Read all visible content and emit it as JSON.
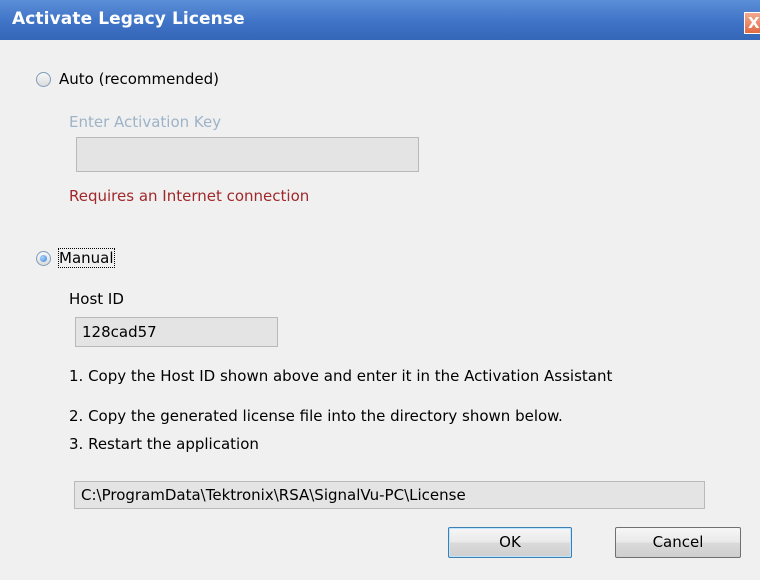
{
  "dialog": {
    "title": "Activate Legacy License",
    "close_label": "X"
  },
  "auto": {
    "label": "Auto (recommended)",
    "selected": false,
    "key_label": "Enter Activation Key",
    "key_value": "",
    "internet_note": "Requires an Internet connection"
  },
  "manual": {
    "label": "Manual",
    "selected": true,
    "host_id_label": "Host ID",
    "host_id_value": "128cad57",
    "steps": [
      "1. Copy the Host ID shown above and enter it in the Activation Assistant",
      "2. Copy the generated license file into the directory shown below.",
      "3. Restart the application"
    ],
    "license_path": "C:\\ProgramData\\Tektronix\\RSA\\SignalVu-PC\\License"
  },
  "buttons": {
    "ok": "OK",
    "cancel": "Cancel"
  }
}
